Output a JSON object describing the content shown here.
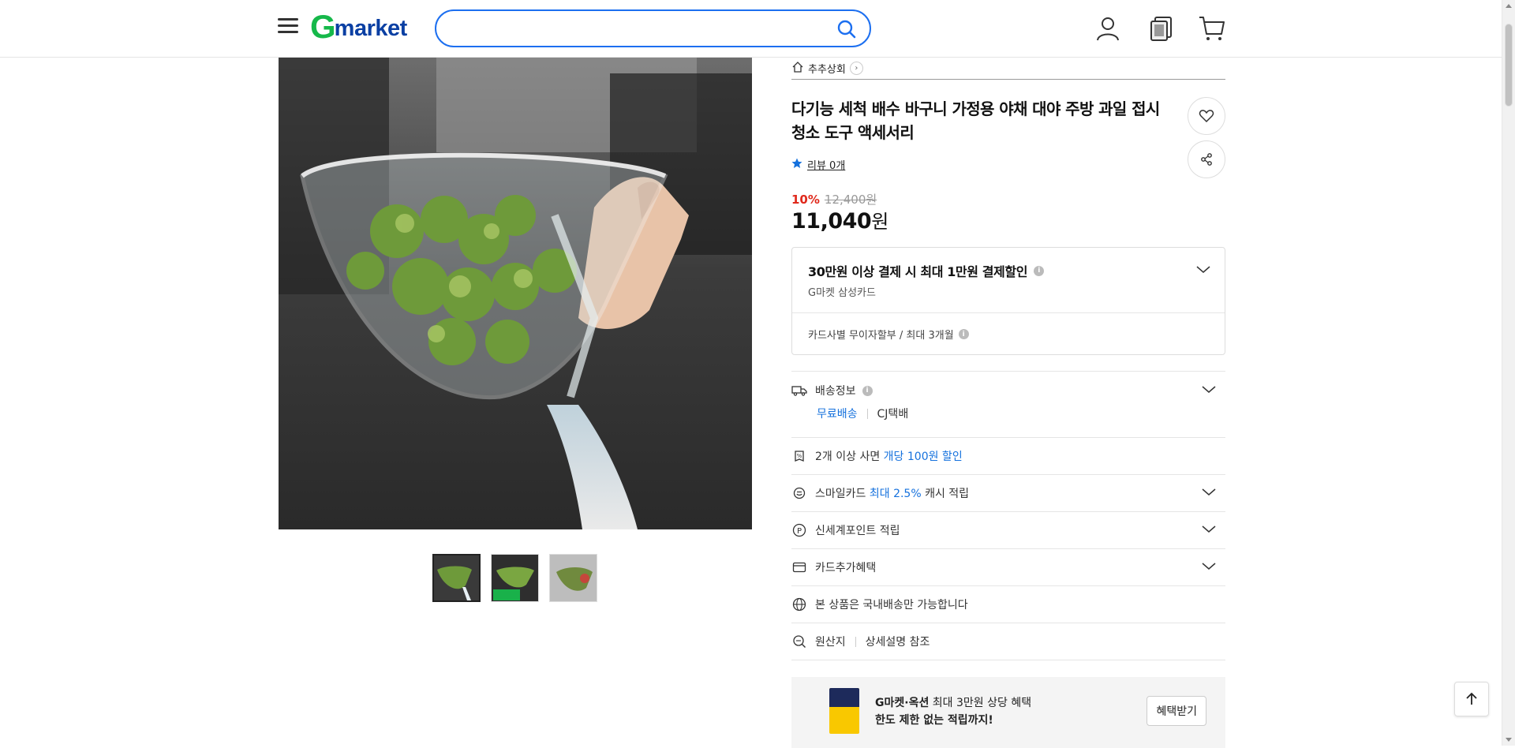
{
  "header": {
    "logo_g": "G",
    "logo_market": "market",
    "search": {
      "value": "",
      "placeholder": ""
    },
    "icons": [
      "menu-icon",
      "search-icon",
      "my-page-icon",
      "recent-items-icon",
      "cart-icon"
    ]
  },
  "product": {
    "shop_name": "추추상회",
    "title": "다기능 세척 배수 바구니 가정용 야채 대야 주방 과일 접시 청소 도구 액세서리",
    "review_label": "리뷰 0개",
    "discount_rate": "10%",
    "original_price": "12,400원",
    "sale_price_number": "11,040",
    "sale_price_unit": "원",
    "image_count": 3,
    "active_image_index": 0
  },
  "card_promo": {
    "title": "30만원 이상 결제 시 최대 1만원 결제할인",
    "subtitle": "G마켓 삼성카드",
    "installment": "카드사별 무이자할부 / 최대 3개월"
  },
  "info_rows": {
    "shipping_label": "배송정보",
    "shipping_free": "무료배송",
    "shipping_carrier": "CJ택배",
    "bulk_prefix": "2개 이상 사면 ",
    "bulk_highlight": "개당 100원 할인",
    "smile_prefix": "스마일카드 ",
    "smile_highlight": "최대 2.5%",
    "smile_suffix": " 캐시 적립",
    "ssg_point": "신세계포인트 적립",
    "card_extra": "카드추가혜택",
    "domestic_only": "본 상품은 국내배송만 가능합니다",
    "origin_label": "원산지",
    "origin_value": "상세설명 참조"
  },
  "benefit_banner": {
    "line1_bold": "G마켓·옥션",
    "line1_rest": " 최대 3만원 상당 혜택",
    "line2": "한도 제한 없는 적립까지!",
    "button": "혜택받기"
  },
  "colors": {
    "brand_green": "#16b84a",
    "brand_navy": "#0a3fa3",
    "search_blue": "#1c6ff0",
    "discount_red": "#e0291c",
    "link_blue": "#1571dd"
  }
}
